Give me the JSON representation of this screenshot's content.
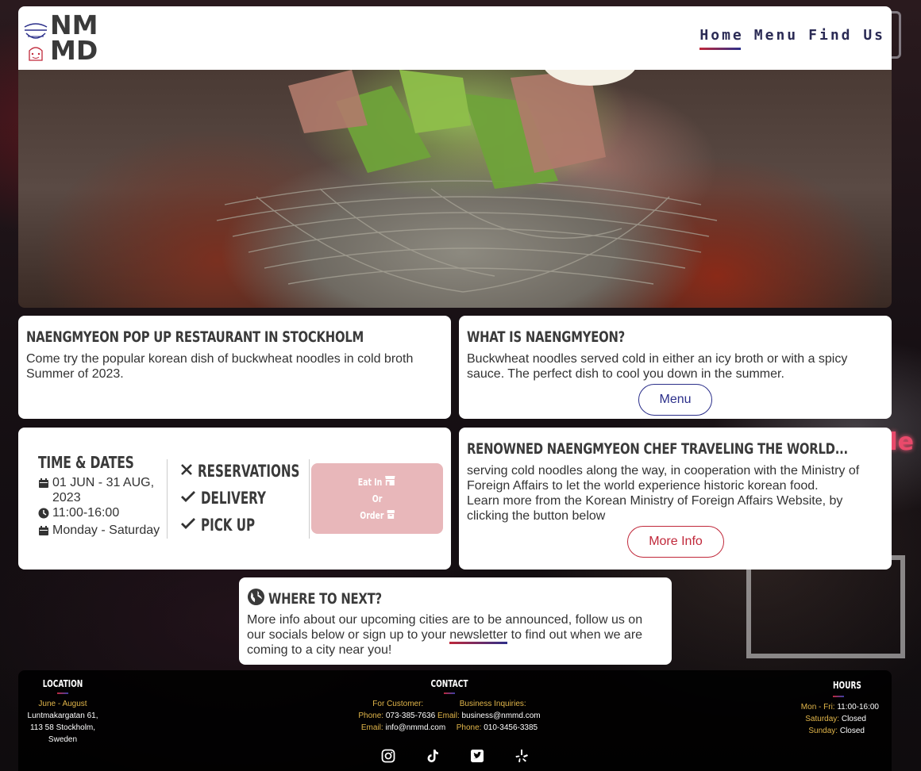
{
  "nav": {
    "logo_top": "NM",
    "logo_bottom": "MD",
    "items": [
      {
        "label": "Home",
        "active": true
      },
      {
        "label": "Menu",
        "active": false
      },
      {
        "label": "Find Us",
        "active": false
      }
    ]
  },
  "popup": {
    "title": "NAENGMYEON POP UP RESTAURANT IN STOCKHOLM",
    "text": "Come try the popular korean dish of buckwheat noodles in cold broth Summer of 2023."
  },
  "what": {
    "title": "WHAT IS NAENGMYEON?",
    "text": "Buckwheat noodles served cold in either an icy broth or with a spicy sauce. The perfect dish to cool you down in the summer.",
    "button": "Menu"
  },
  "time": {
    "title": "TIME & DATES",
    "dates": "01 JUN - 31 AUG, 2023",
    "hours": "11:00-16:00",
    "days": "Monday - Saturday"
  },
  "services": [
    {
      "label": "RESERVATIONS",
      "available": false
    },
    {
      "label": "DELIVERY",
      "available": true
    },
    {
      "label": "PICK UP",
      "available": true
    }
  ],
  "order": {
    "eat_in": "Eat In",
    "or": "Or",
    "order": "Order"
  },
  "chef": {
    "title": "RENOWNED NAENGMYEON CHEF TRAVELING THE WORLD...",
    "text1": "serving cold noodles along the way, in cooperation with the Ministry of Foreign Affairs to let the world experience historic korean food.",
    "text2": "Learn more from the Korean Ministry of Foreign Affairs Website, by clicking the button below",
    "button": "More Info"
  },
  "next": {
    "title": "WHERE TO NEXT?",
    "text_before": "More info about our upcoming cities are to be announced, follow us on our socials below or sign up to your ",
    "link": "newsletter",
    "text_after": " to find out when we are coming to a city near you!"
  },
  "footer": {
    "location": {
      "heading": "LOCATION",
      "period": "June  -  August",
      "address1": "Luntmakargatan  61,",
      "address2": "113  58  Stockholm,",
      "address3": "Sweden"
    },
    "contact": {
      "heading": "CONTACT",
      "customer_label": "For  Customer:",
      "business_label": "Business  Inquiries:",
      "phone_label": "Phone:",
      "phone": "073-385-7636",
      "email_label": "Email:",
      "business_email": "business@nmmd.com",
      "email_label2": "Email:",
      "email": "info@nmmd.com",
      "phone_label2": "Phone:",
      "business_phone": "010-3456-3385"
    },
    "hours": {
      "heading": "HOURS",
      "weekday_label": "Mon  -  Fri:",
      "weekday": "11:00-16:00",
      "saturday_label": "Saturday:",
      "saturday": "Closed",
      "sunday_label": "Sunday:",
      "sunday": "Closed"
    },
    "socials": [
      "instagram-icon",
      "tiktok-icon",
      "twitter-icon",
      "yelp-icon"
    ]
  },
  "colors": {
    "accent_red": "#c0283a",
    "accent_blue": "#2b2f8a",
    "order_pink": "#e8b7ba",
    "gold": "#e2b64a"
  }
}
